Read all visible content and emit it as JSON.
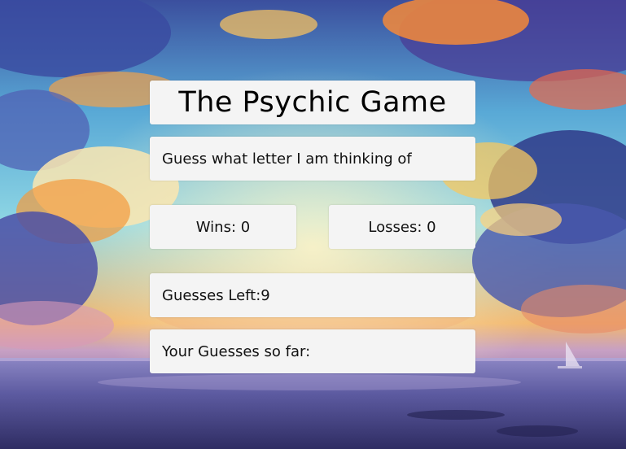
{
  "game": {
    "title": "The Psychic Game",
    "prompt": "Guess what letter I am thinking of",
    "wins_label": "Wins: ",
    "wins": "0",
    "losses_label": "Losses: ",
    "losses": "0",
    "guesses_left_label": "Guesses Left:",
    "guesses_left": "9",
    "guesses_so_far_label": "Your Guesses so far:",
    "guesses_so_far": ""
  },
  "colors": {
    "card_bg": "#f4f4f4",
    "sky_top": "#2d3f86",
    "sky_mid": "#6fc7e0",
    "cloud_orange": "#f49a3c",
    "cloud_blue": "#4a5db0",
    "sea": "#4b4a8a"
  }
}
